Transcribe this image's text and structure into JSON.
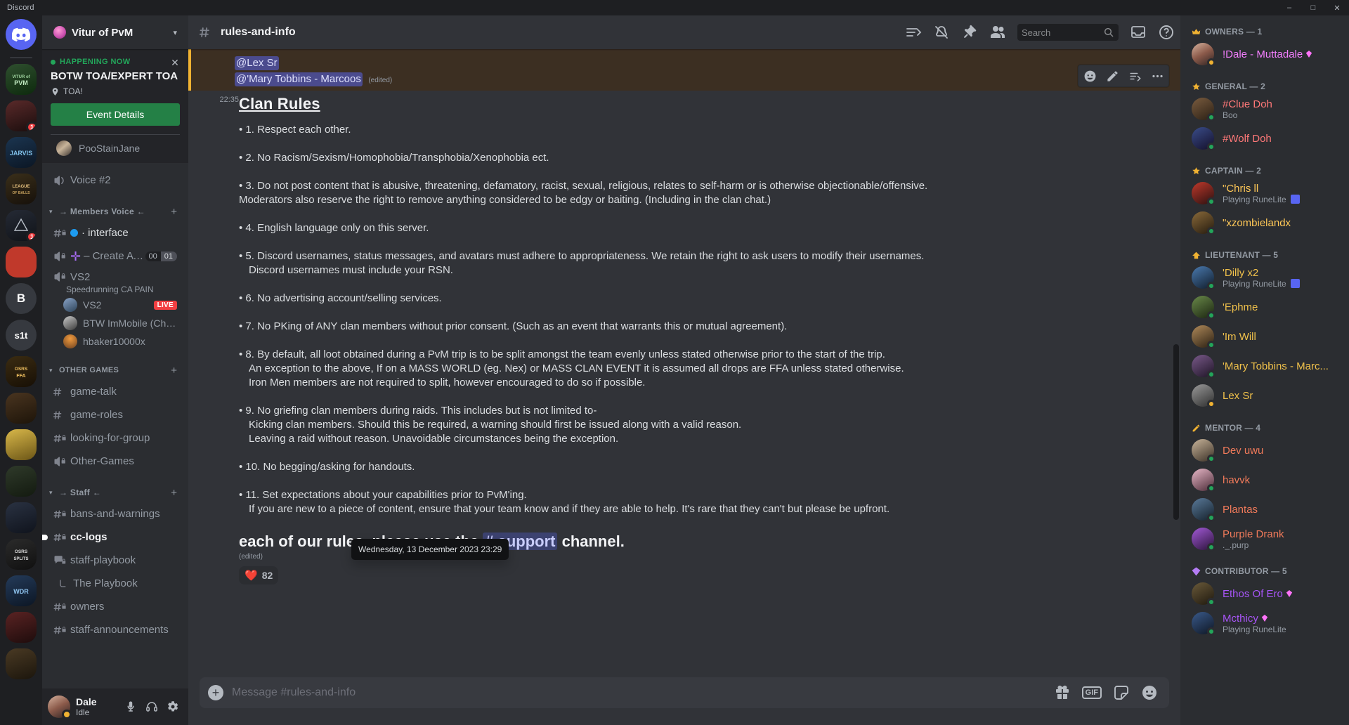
{
  "window": {
    "app_title": "Discord",
    "minimize": "–",
    "maximize": "□",
    "close": "✕"
  },
  "guild_rail": {
    "items": [
      {
        "name": "home",
        "label": "",
        "style": "home"
      },
      {
        "name": "vitur-of-pvm",
        "label": "",
        "style": "sel",
        "badge": ""
      },
      {
        "name": "server-2",
        "label": "",
        "badge": "1"
      },
      {
        "name": "jarvis",
        "label": ""
      },
      {
        "name": "league",
        "label": ""
      },
      {
        "name": "server-5",
        "label": "",
        "badge": "1"
      },
      {
        "name": "red-server",
        "label": ""
      },
      {
        "name": "b-server",
        "label": "B"
      },
      {
        "name": "s1t-server",
        "label": "s1t"
      },
      {
        "name": "osrs-ffa",
        "label": ""
      },
      {
        "name": "server-10",
        "label": ""
      },
      {
        "name": "server-11",
        "label": ""
      },
      {
        "name": "server-12",
        "label": ""
      },
      {
        "name": "server-13",
        "label": ""
      },
      {
        "name": "osrs-splits",
        "label": ""
      },
      {
        "name": "wdr",
        "label": ""
      },
      {
        "name": "server-16",
        "label": ""
      },
      {
        "name": "server-17",
        "label": ""
      }
    ]
  },
  "sidebar": {
    "guild_name": "Vitur of PvM",
    "event": {
      "status_label": "HAPPENING NOW",
      "title": "BOTW TOA/EXPERT TOA",
      "location": "TOA!",
      "button": "Event Details",
      "close": "✕",
      "attendee": "PooStainJane"
    },
    "channels": [
      {
        "type": "voice",
        "name": "Voice #2"
      }
    ],
    "categories": [
      {
        "label": "→ Members Voice ←",
        "decorated": true,
        "items": [
          {
            "type": "text-locked",
            "name": "· interface",
            "bullet": "#1d9bf0",
            "state": "active"
          },
          {
            "type": "voice-locked",
            "name": "– Create A C...",
            "plus": true,
            "slots_used": "00",
            "slots_max": "01"
          },
          {
            "type": "voice-locked",
            "name": "VS2",
            "subtitle": "Speedrunning CA PAIN",
            "members": [
              {
                "name": "VS2",
                "live": "LIVE"
              },
              {
                "name": "BTW ImMobile (Ched)"
              },
              {
                "name": "hbaker10000x"
              }
            ]
          }
        ]
      },
      {
        "label": "OTHER GAMES",
        "decorated": false,
        "items": [
          {
            "type": "text",
            "name": "game-talk"
          },
          {
            "type": "text",
            "name": "game-roles"
          },
          {
            "type": "text-locked",
            "name": "looking-for-group"
          },
          {
            "type": "voice-locked",
            "name": "Other-Games"
          }
        ]
      },
      {
        "label": "→ Staff ←",
        "decorated": true,
        "items": [
          {
            "type": "text-locked",
            "name": "bans-and-warnings"
          },
          {
            "type": "text-locked",
            "name": "cc-logs",
            "state": "unread"
          },
          {
            "type": "forum-locked",
            "name": "staff-playbook"
          },
          {
            "type": "thread",
            "name": "The Playbook"
          },
          {
            "type": "text-locked",
            "name": "owners"
          },
          {
            "type": "text-locked",
            "name": "staff-announcements"
          }
        ]
      }
    ],
    "user": {
      "name": "Dale",
      "status": "Idle"
    }
  },
  "channel_header": {
    "title": "rules-and-info",
    "icons": [
      "threads-icon",
      "notification-off-icon",
      "pin-icon",
      "members-icon"
    ],
    "search_placeholder": "Search",
    "inbox_icon": "inbox-icon",
    "help_icon": "help-icon"
  },
  "message": {
    "mentions": [
      "@Lex Sr",
      "@'Mary Tobbins - Marcoos"
    ],
    "mention_edited": "(edited)",
    "timestamp": "22:35",
    "title": "Clan Rules",
    "rules": [
      {
        "main": "• 1.  Respect each other.",
        "subs": []
      },
      {
        "main": "• 2. No Racism/Sexism/Homophobia/Transphobia/Xenophobia ect.",
        "subs": []
      },
      {
        "main": "• 3. Do not post content that is abusive, threatening, defamatory, racist, sexual, religious, relates to self-harm or is otherwise objectionable/offensive. Moderators also reserve the right to remove anything considered to be edgy or baiting. (Including in the clan chat.)",
        "subs": []
      },
      {
        "main": "• 4. English language only on this server.",
        "subs": []
      },
      {
        "main": "• 5. Discord usernames, status messages, and avatars must adhere to appropriateness. We retain the right to ask users to modify their usernames.",
        "subs": [
          "Discord usernames must include your RSN."
        ]
      },
      {
        "main": "• 6. No advertising account/selling services.",
        "subs": []
      },
      {
        "main": "• 7. No PKing of ANY clan members without prior consent. (Such as an event that warrants this or mutual agreement).",
        "subs": []
      },
      {
        "main": "• 8. By default, all loot obtained during a PvM trip is to be split amongst the team evenly unless stated otherwise prior to the start of the trip.",
        "subs": [
          "An exception to the above, If on a MASS WORLD  (eg. Nex) or MASS CLAN EVENT it is assumed all drops are FFA unless stated otherwise.",
          "Iron Men members are not required to split, however encouraged to do so if possible."
        ]
      },
      {
        "main": "• 9. No griefing clan members during raids. This includes but is not limited to-",
        "subs": [
          "Kicking clan members. Should this be required, a warning should first be issued along with a valid reason.",
          "Leaving a raid without reason. Unavoidable circumstances being the exception."
        ]
      },
      {
        "main": "• 10. No begging/asking for handouts.",
        "subs": []
      },
      {
        "main": "• 11. Set expectations about your capabilities prior to PvM'ing.",
        "subs": [
          "If you are new to a piece of content, ensure that your team know and if they are able to help. It's rare that they can't but please be upfront."
        ]
      }
    ],
    "closing_prefix": "each of our rules, please use the ",
    "closing_channel": "# support",
    "closing_suffix": " channel.",
    "edited": "(edited)",
    "reaction_emoji": "❤️",
    "reaction_count": "82",
    "tooltip": "Wednesday, 13 December 2023 23:29"
  },
  "composer": {
    "placeholder": "Message #rules-and-info",
    "gif_label": "GIF"
  },
  "members": {
    "groups": [
      {
        "label": "OWNERS — 1",
        "icon": "crown-icon",
        "icon_color": "#f0b232",
        "items": [
          {
            "name": "!Dale - Muttadale",
            "color": "#f47fff",
            "status": "idle",
            "gem": "#ff73fa",
            "sub": ""
          }
        ]
      },
      {
        "label": "GENERAL — 2",
        "icon": "star-icon",
        "icon_color": "#f0b232",
        "items": [
          {
            "name": "#Clue Doh",
            "color": "#ff7878",
            "status": "online",
            "sub": "Boo"
          },
          {
            "name": "#Wolf Doh",
            "color": "#ff7878",
            "status": "online",
            "sub": ""
          }
        ]
      },
      {
        "label": "CAPTAIN — 2",
        "icon": "star-icon",
        "icon_color": "#f0b232",
        "items": [
          {
            "name": "\"Chris ll",
            "color": "#ffc857",
            "status": "online",
            "sub": "Playing RuneLite",
            "sub_icon": true
          },
          {
            "name": "\"xzombielandx",
            "color": "#ffc857",
            "status": "online",
            "sub": ""
          }
        ]
      },
      {
        "label": "LIEUTENANT — 5",
        "icon": "chevron-icon",
        "icon_color": "#f0b232",
        "items": [
          {
            "name": "'Dilly x2",
            "color": "#f0c14b",
            "status": "online",
            "sub": "Playing RuneLite",
            "sub_icon": true
          },
          {
            "name": "'Ephme",
            "color": "#f0c14b",
            "status": "online",
            "sub": ""
          },
          {
            "name": "'Im Will",
            "color": "#f0c14b",
            "status": "online",
            "sub": ""
          },
          {
            "name": "'Mary Tobbins - Marc...",
            "color": "#f0c14b",
            "status": "online",
            "sub": ""
          },
          {
            "name": "Lex Sr",
            "color": "#f0c14b",
            "status": "idle",
            "sub": ""
          }
        ]
      },
      {
        "label": "MENTOR — 4",
        "icon": "pencil-icon",
        "icon_color": "#f0b232",
        "items": [
          {
            "name": "Dev uwu",
            "color": "#f07a5a",
            "status": "online",
            "sub": ""
          },
          {
            "name": "havvk",
            "color": "#f07a5a",
            "status": "online",
            "sub": ""
          },
          {
            "name": "Plantas",
            "color": "#f07a5a",
            "status": "online",
            "sub": ""
          },
          {
            "name": "Purple Drank",
            "color": "#f07a5a",
            "status": "online",
            "sub": "._.purp"
          }
        ]
      },
      {
        "label": "CONTRIBUTOR — 5",
        "icon": "gem-icon",
        "icon_color": "#b47cf5",
        "items": [
          {
            "name": "Ethos Of Ero",
            "color": "#a855f7",
            "status": "online",
            "gem": "#ff73fa",
            "sub": ""
          },
          {
            "name": "Mcthicy",
            "color": "#a855f7",
            "status": "online",
            "gem": "#ff73fa",
            "sub": "Playing RuneLite",
            "sub_icon": true
          }
        ]
      }
    ]
  }
}
